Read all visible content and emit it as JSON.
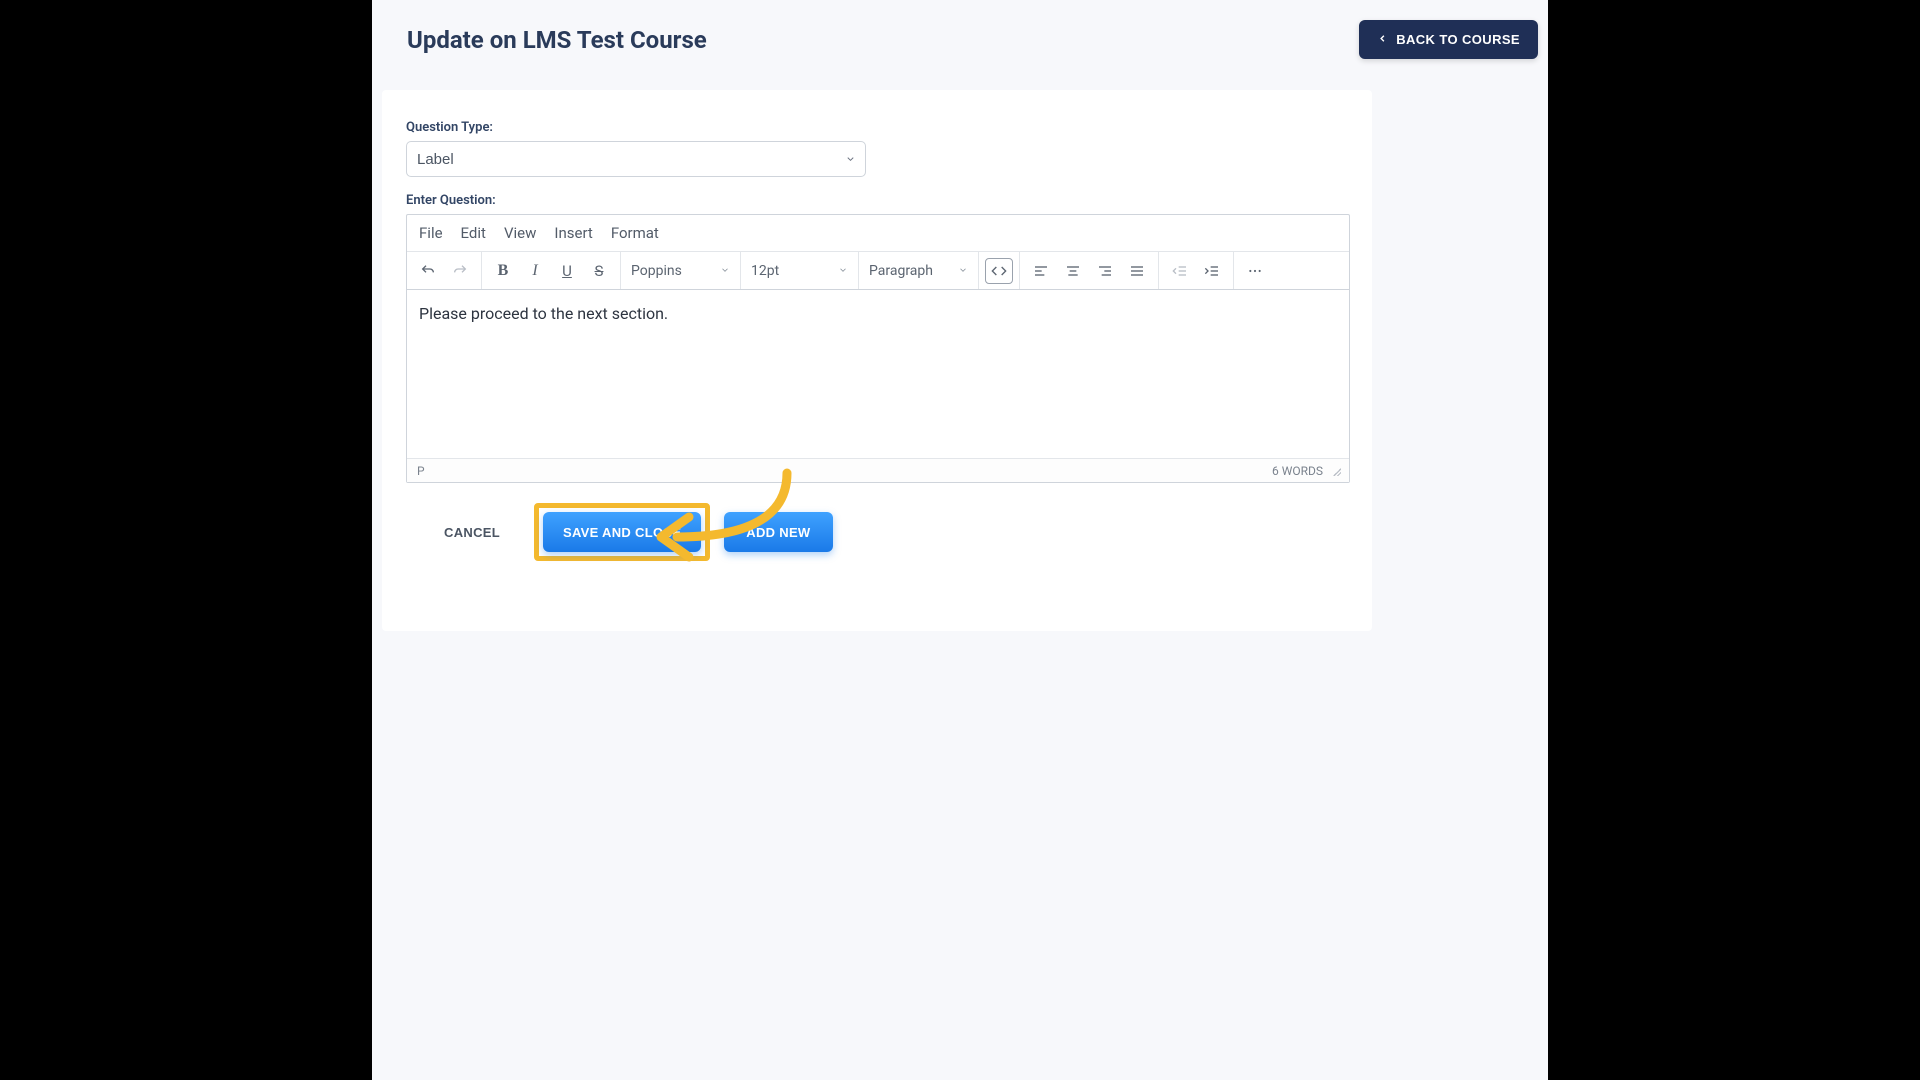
{
  "header": {
    "title": "Update on LMS Test Course",
    "back_label": "BACK TO COURSE"
  },
  "form": {
    "question_type_label": "Question Type:",
    "question_type_value": "Label",
    "enter_question_label": "Enter Question:"
  },
  "editor": {
    "menus": [
      "File",
      "Edit",
      "View",
      "Insert",
      "Format"
    ],
    "font_family": "Poppins",
    "font_size": "12pt",
    "block_format": "Paragraph",
    "content": "Please proceed to the next section.",
    "path": "P",
    "word_count": "6 WORDS"
  },
  "actions": {
    "cancel": "CANCEL",
    "save_close": "SAVE AND CLOSE",
    "add_new": "ADD NEW"
  },
  "annotation": {
    "highlight_target": "save_close",
    "arrow_points_to": "save_close"
  },
  "colors": {
    "accent_dark": "#1f2f56",
    "accent_blue": "#1a7ae8",
    "highlight": "#f4b92e"
  }
}
